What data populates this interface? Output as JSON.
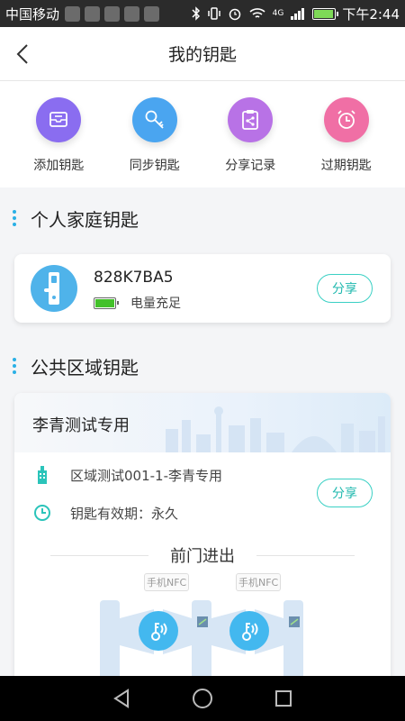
{
  "status_bar": {
    "carrier": "中国移动",
    "network": "4G",
    "time": "下午2:44"
  },
  "header": {
    "title": "我的钥匙"
  },
  "actions": [
    {
      "label": "添加钥匙",
      "icon": "add-key-icon",
      "color": "#8a6df0"
    },
    {
      "label": "同步钥匙",
      "icon": "sync-key-icon",
      "color": "#4aa5f0"
    },
    {
      "label": "分享记录",
      "icon": "share-record-icon",
      "color": "#b872e6"
    },
    {
      "label": "过期钥匙",
      "icon": "expired-key-icon",
      "color": "#f06fa5"
    }
  ],
  "personal": {
    "section_title": "个人家庭钥匙",
    "key_name": "828K7BA5",
    "battery_text": "电量充足",
    "share_label": "分享"
  },
  "public": {
    "section_title": "公共区域钥匙",
    "area_name": "李青测试专用",
    "area_detail": "区域测试001-1-李青专用",
    "validity": "钥匙有效期：永久",
    "share_label": "分享",
    "door_title": "前门进出",
    "nfc_left": "手机NFC",
    "nfc_right": "手机NFC"
  },
  "colors": {
    "accent": "#2ab0e6",
    "share": "#3ad0c4"
  }
}
